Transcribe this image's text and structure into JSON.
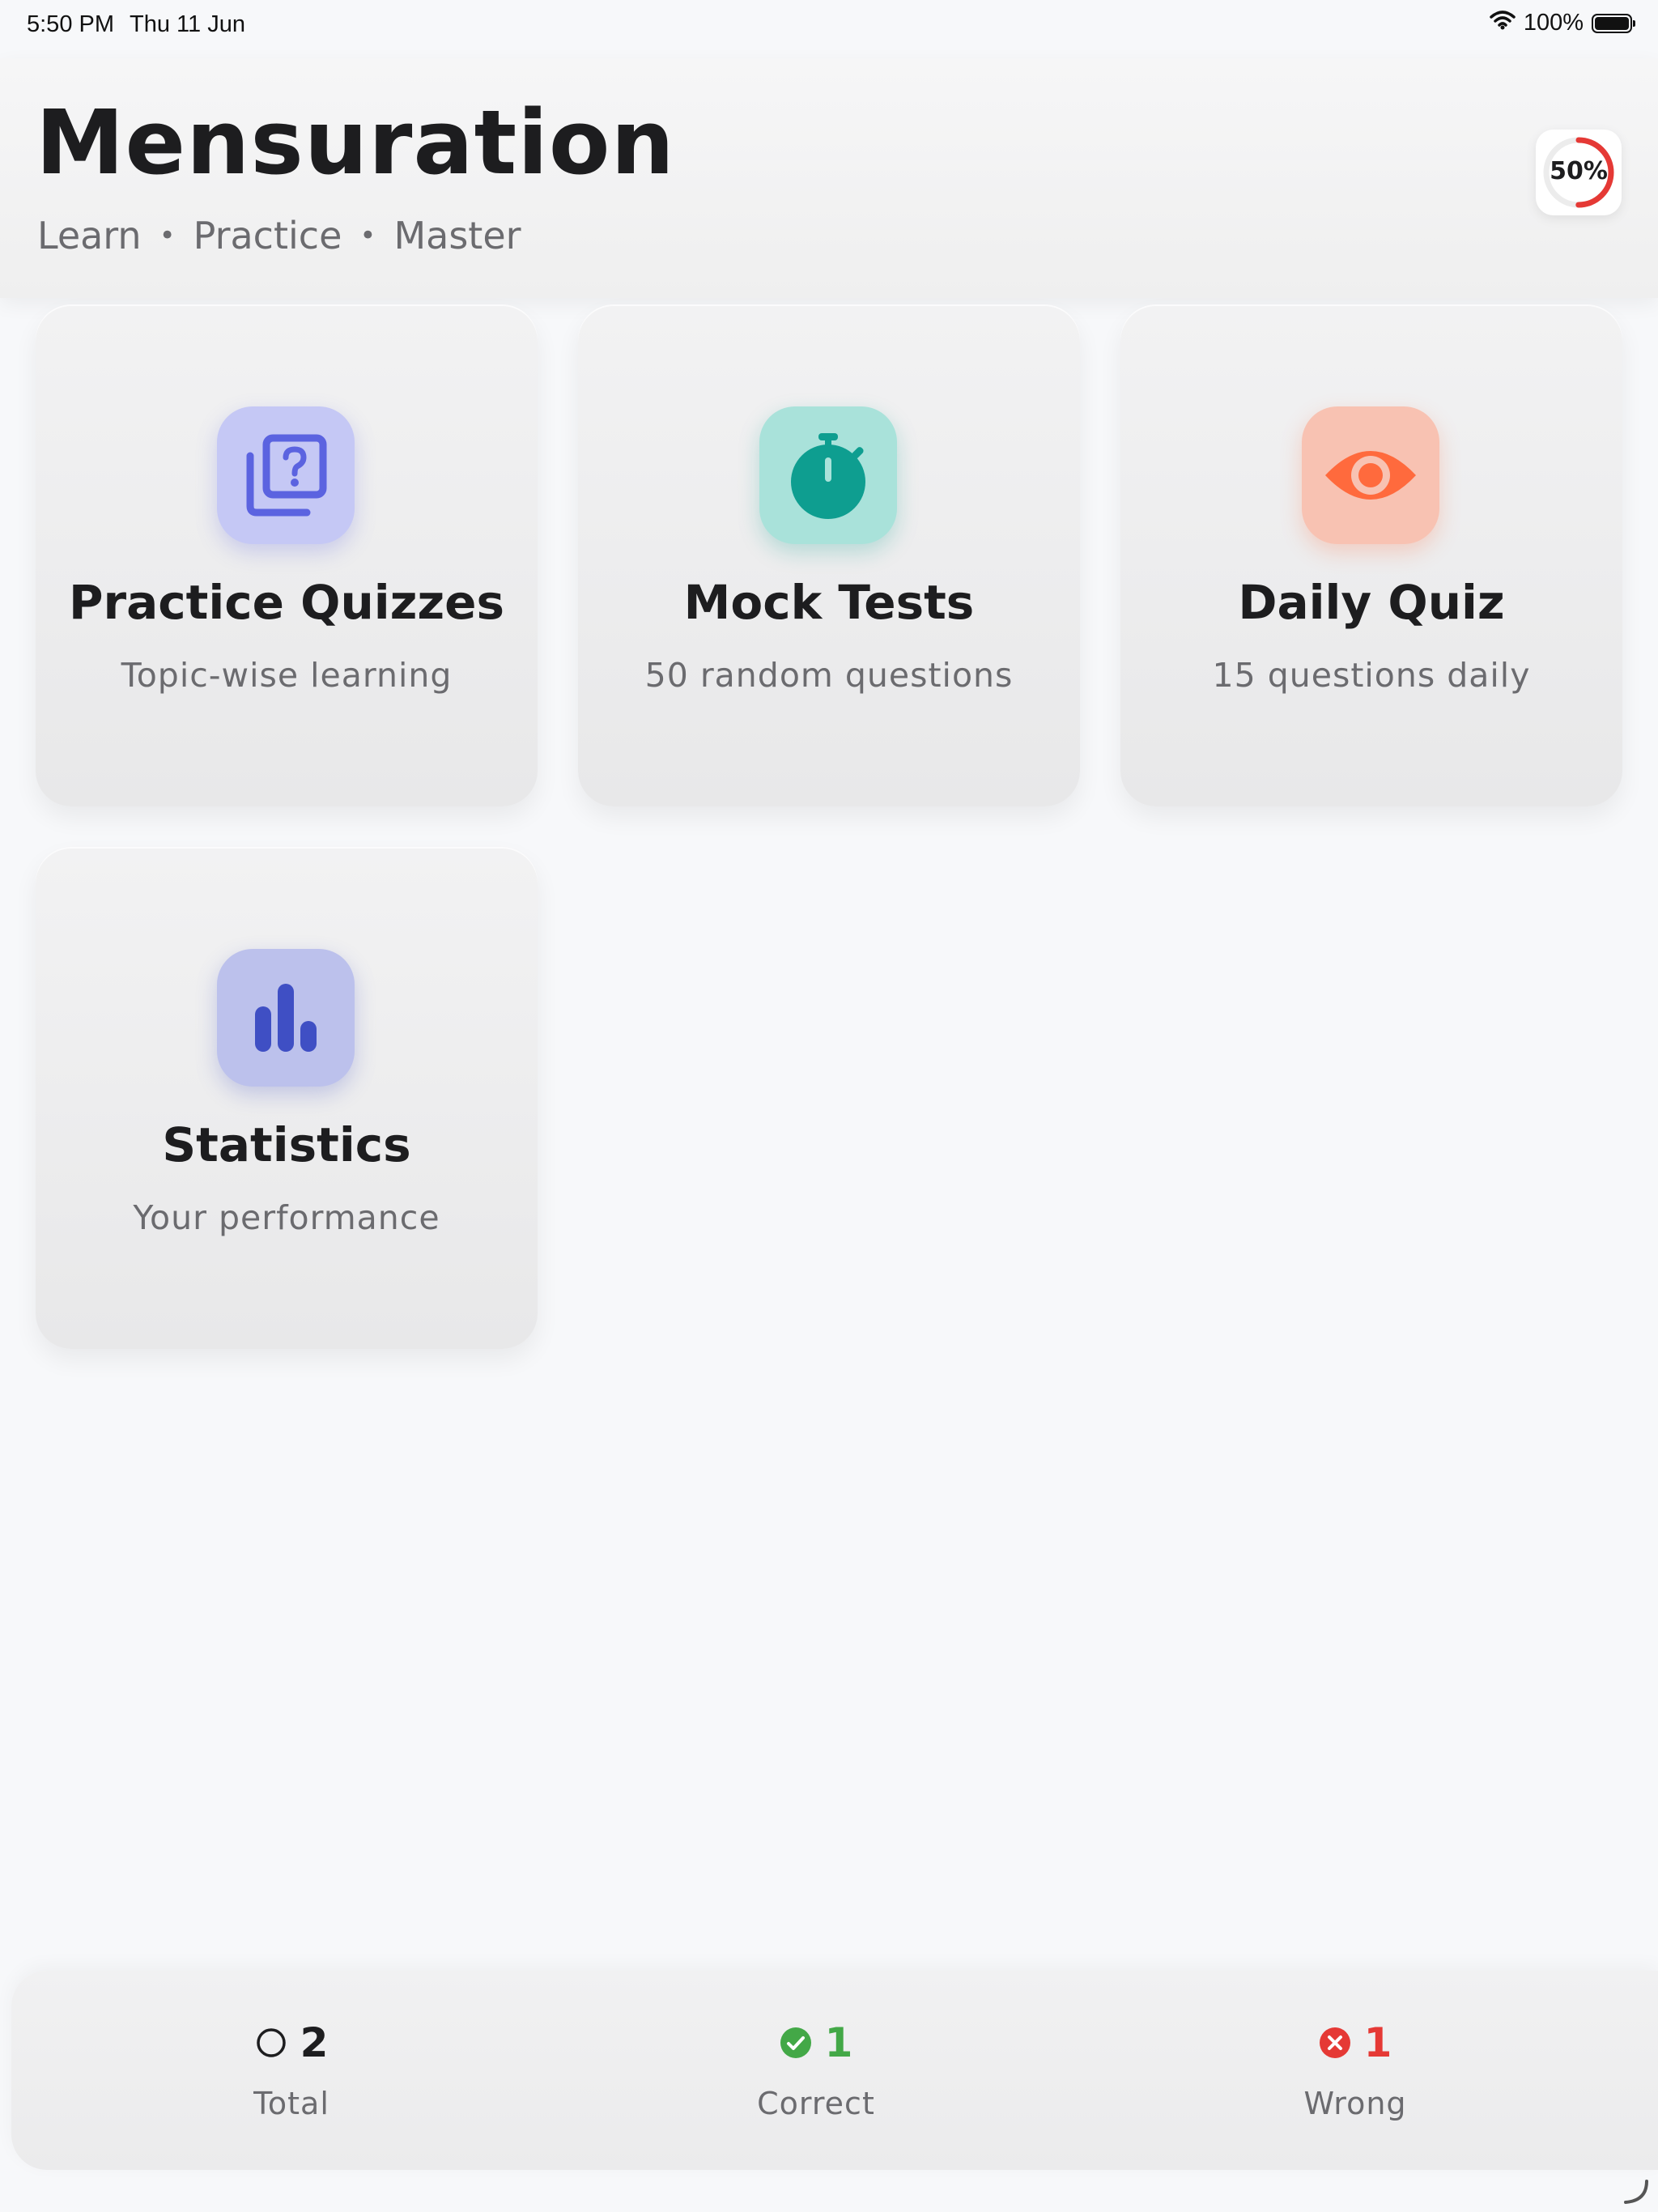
{
  "status_bar": {
    "time": "5:50 PM",
    "date": "Thu 11 Jun",
    "battery": "100%"
  },
  "header": {
    "title": "Mensuration",
    "subtitle": [
      "Learn",
      "Practice",
      "Master"
    ],
    "progress": {
      "label": "50%",
      "fraction": 0.5
    }
  },
  "cards": [
    {
      "title": "Practice Quizzes",
      "subtitle": "Topic-wise learning",
      "icon": "quiz-question-icon",
      "icon_color": "#5b63e0",
      "tile_color": "#c5c8f5"
    },
    {
      "title": "Mock Tests",
      "subtitle": "50 random questions",
      "icon": "stopwatch-icon",
      "icon_color": "#0e9e90",
      "tile_color": "#a9e2da"
    },
    {
      "title": "Daily Quiz",
      "subtitle": "15 questions daily",
      "icon": "eye-icon",
      "icon_color": "#ff6a3d",
      "tile_color": "#f8c2b2"
    },
    {
      "title": "Statistics",
      "subtitle": "Your performance",
      "icon": "bar-chart-icon",
      "icon_color": "#3f4fc4",
      "tile_color": "#bcc1ec"
    }
  ],
  "stats": [
    {
      "value": "2",
      "label": "Total",
      "icon": "circle-outline-icon",
      "color": "#1d1d1f"
    },
    {
      "value": "1",
      "label": "Correct",
      "icon": "check-circle-icon",
      "color": "#43a847"
    },
    {
      "value": "1",
      "label": "Wrong",
      "icon": "x-circle-icon",
      "color": "#e53935"
    }
  ],
  "colors": {
    "background": "#f7f8fa",
    "progress_ring": "#e53935"
  }
}
